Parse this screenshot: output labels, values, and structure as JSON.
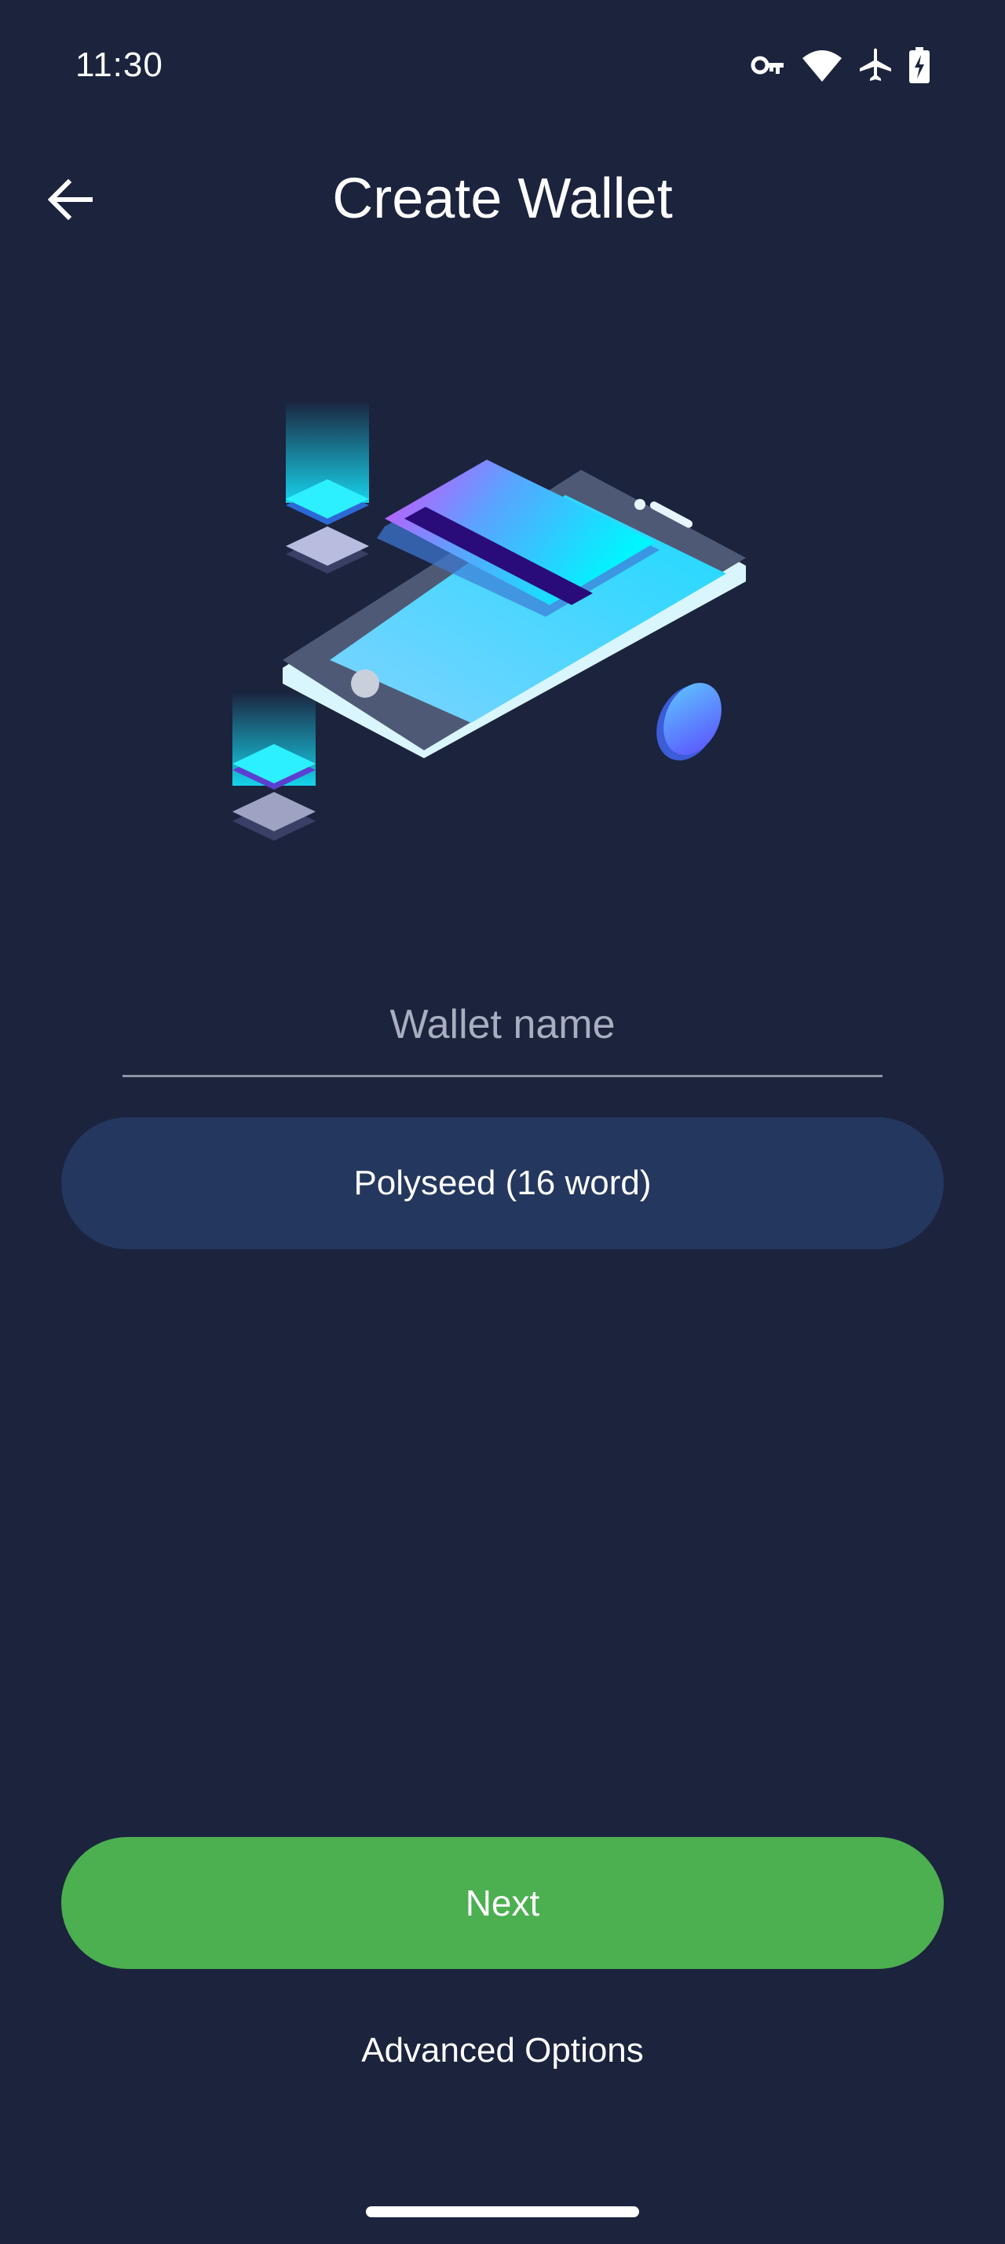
{
  "status_bar": {
    "time": "11:30",
    "icons": [
      "vpn-key-icon",
      "wifi-icon",
      "airplane-icon",
      "battery-charging-icon"
    ]
  },
  "header": {
    "title": "Create Wallet",
    "back_icon": "arrow-left-icon"
  },
  "form": {
    "wallet_name_placeholder": "Wallet name",
    "wallet_name_value": "",
    "seed_type_label": "Polyseed (16 word)"
  },
  "actions": {
    "next_label": "Next",
    "advanced_label": "Advanced Options"
  },
  "colors": {
    "background": "#1b233d",
    "seed_pill": "#24375e",
    "primary": "#4caf50"
  }
}
